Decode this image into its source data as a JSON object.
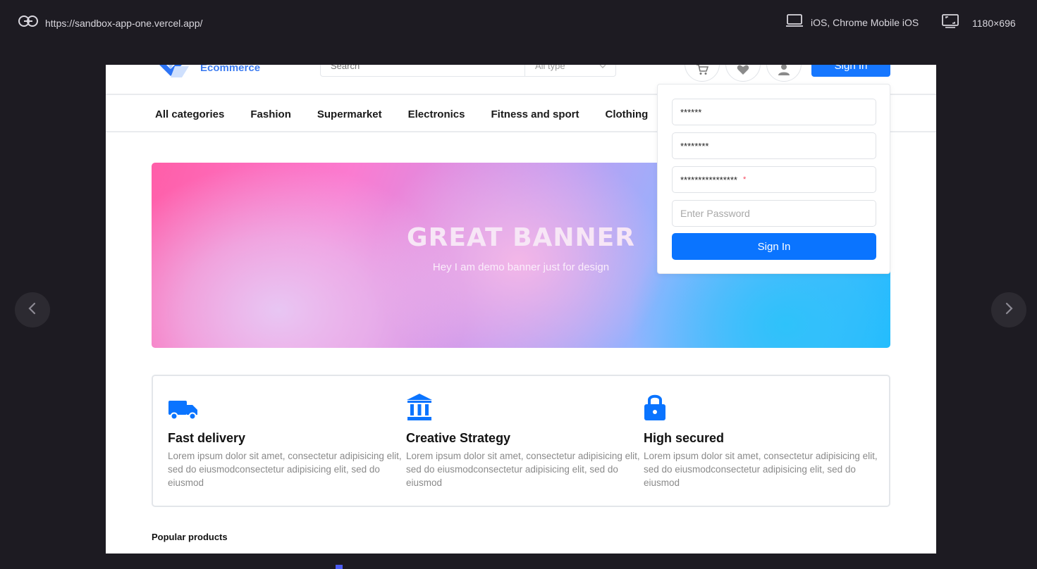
{
  "viewer": {
    "url": "https://sandbox-app-one.vercel.app/",
    "device": "iOS, Chrome Mobile iOS",
    "size": "1180×696"
  },
  "header": {
    "logo_text": "Ecommerce",
    "search_placeholder": "Search",
    "search_type": "All type",
    "signin_label": "Sign In"
  },
  "categories": [
    "All categories",
    "Fashion",
    "Supermarket",
    "Electronics",
    "Fitness and sport",
    "Clothing"
  ],
  "banner": {
    "title": "GREAT BANNER",
    "subtitle": "Hey I am demo banner just for design"
  },
  "features": [
    {
      "title": "Fast delivery",
      "desc": "Lorem ipsum dolor sit amet, consectetur adipisicing elit, sed do eiusmodconsectetur adipisicing elit, sed do eiusmod"
    },
    {
      "title": "Creative Strategy",
      "desc": "Lorem ipsum dolor sit amet, consectetur adipisicing elit, sed do eiusmodconsectetur adipisicing elit, sed do eiusmod"
    },
    {
      "title": "High secured",
      "desc": "Lorem ipsum dolor sit amet, consectetur adipisicing elit, sed do eiusmodconsectetur adipisicing elit, sed do eiusmod"
    }
  ],
  "popular_title": "Popular products",
  "signin_dropdown": {
    "field1": "******",
    "field2": "********",
    "field3": "****************",
    "field3_required": "*",
    "password_placeholder": "Enter Password",
    "button_label": "Sign In"
  },
  "colors": {
    "primary": "#1677ff",
    "logo": "#3d7cf0"
  }
}
